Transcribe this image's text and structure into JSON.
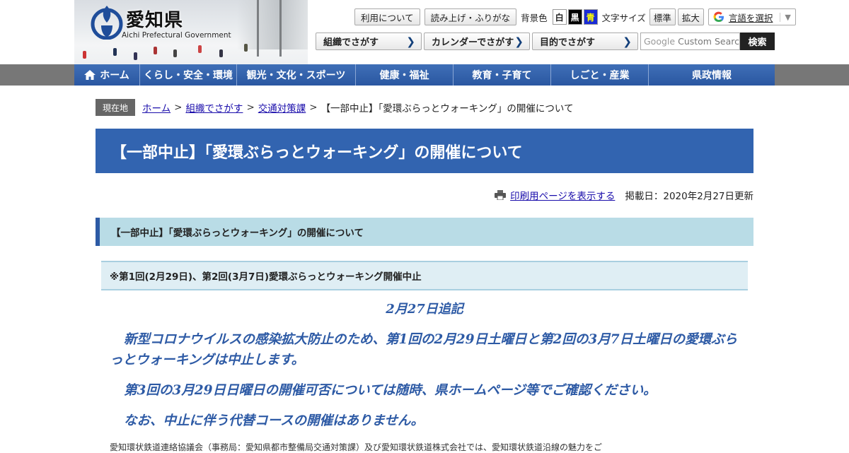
{
  "header": {
    "logo_ja": "愛知県",
    "logo_en": "Aichi Prefectural Government",
    "utility": {
      "usage": "利用について",
      "read_aloud": "読み上げ・ふりがな",
      "bg_label": "背景色",
      "bg_white": "白",
      "bg_black": "黒",
      "bg_blue": "青",
      "font_label": "文字サイズ",
      "font_normal": "標準",
      "font_large": "拡大",
      "language": "言語を選択"
    },
    "search_nav": {
      "org": "組織でさがす",
      "calendar": "カレンダーでさがす",
      "purpose": "目的でさがす"
    },
    "search": {
      "placeholder": "Custom Search",
      "google": "Google",
      "button": "検索"
    }
  },
  "global_nav": [
    {
      "label": "ホーム"
    },
    {
      "label": "くらし・安全・環境"
    },
    {
      "label": "観光・文化・スポーツ"
    },
    {
      "label": "健康・福祉"
    },
    {
      "label": "教育・子育て"
    },
    {
      "label": "しごと・産業"
    },
    {
      "label": "県政情報"
    }
  ],
  "breadcrumb": {
    "label": "現在地",
    "items": [
      "ホーム",
      "組織でさがす",
      "交通対策課"
    ],
    "current": "【一部中止】「愛環ぶらっとウォーキング」の開催について",
    "sep": ">"
  },
  "page": {
    "title": "【一部中止】「愛環ぶらっとウォーキング」の開催について",
    "print_link": "印刷用ページを表示する",
    "posted": "掲載日：2020年2月27日更新",
    "h2": "【一部中止】「愛環ぶらっとウォーキング」の開催について",
    "h3": "※第1回(2月29日)、第2回(3月7日)愛環ぶらっとウォーキング開催中止",
    "addendum": "2月27日追記",
    "para1": "新型コロナウイルスの感染拡大防止のため、第1回の2月29日土曜日と第2回の3月7日土曜日の愛環ぶらっとウォーキングは中止します。",
    "para2": "第3回の3月29日日曜日の開催可否については随時、県ホームページ等でご確認ください。",
    "para3": "なお、中止に伴う代替コースの開催はありません。",
    "para4": "愛知環状鉄道連絡協議会（事務局：愛知県都市整備局交通対策課）及び愛知環状鉄道株式会社では、愛知環状鉄道沿線の魅力をご"
  },
  "colors": {
    "nav_blue": "#2a57a1",
    "title_blue": "#3264b0",
    "h2_bg": "#b9dce6",
    "text_blue": "#2d5aa5"
  }
}
